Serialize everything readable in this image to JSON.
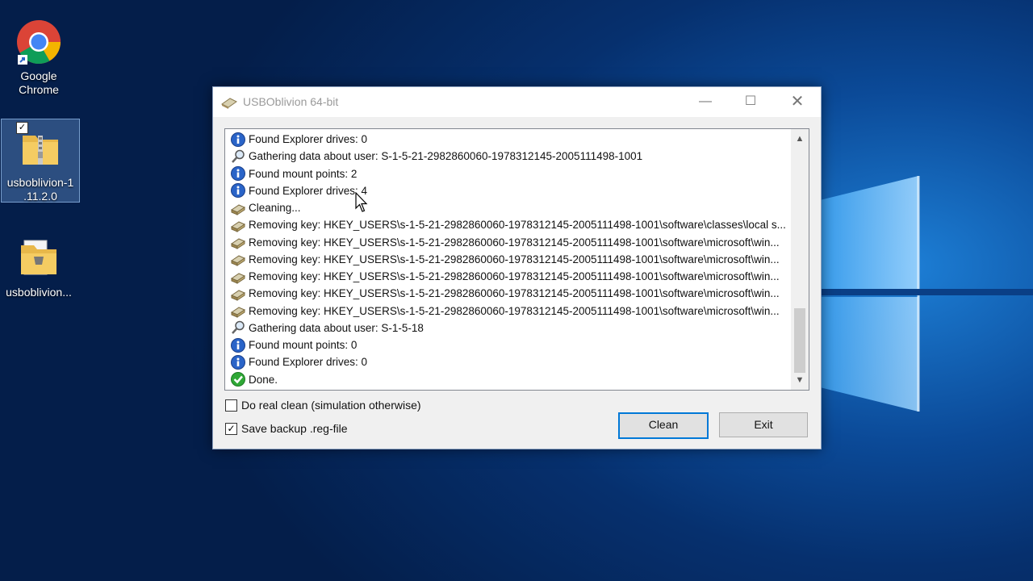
{
  "desktop": {
    "icons": [
      {
        "label": "Google Chrome",
        "label_lines": [
          "Google",
          "Chrome"
        ]
      },
      {
        "label": "usboblivion-1.11.2.0",
        "label_lines": [
          "usboblivion-1",
          ".11.2.0"
        ],
        "checked": "✓"
      },
      {
        "label": "usboblivion...",
        "label_lines": [
          "usboblivion..."
        ]
      }
    ]
  },
  "window": {
    "title": "USBOblivion 64-bit",
    "controls": {
      "minimize": "—",
      "maximize": "☐",
      "close": "✕"
    }
  },
  "log": {
    "lines": [
      {
        "icon": "info-icon",
        "text": "Found Explorer drives: 0"
      },
      {
        "icon": "magnifier-icon",
        "text": "Gathering data about user: S-1-5-21-2982860060-1978312145-2005111498-1001"
      },
      {
        "icon": "info-icon",
        "text": "Found mount points: 2"
      },
      {
        "icon": "info-icon",
        "text": "Found Explorer drives: 4"
      },
      {
        "icon": "eraser-icon",
        "text": "Cleaning..."
      },
      {
        "icon": "eraser-icon",
        "text": "Removing key: HKEY_USERS\\s-1-5-21-2982860060-1978312145-2005111498-1001\\software\\classes\\local s..."
      },
      {
        "icon": "eraser-icon",
        "text": "Removing key: HKEY_USERS\\s-1-5-21-2982860060-1978312145-2005111498-1001\\software\\microsoft\\win..."
      },
      {
        "icon": "eraser-icon",
        "text": "Removing key: HKEY_USERS\\s-1-5-21-2982860060-1978312145-2005111498-1001\\software\\microsoft\\win..."
      },
      {
        "icon": "eraser-icon",
        "text": "Removing key: HKEY_USERS\\s-1-5-21-2982860060-1978312145-2005111498-1001\\software\\microsoft\\win..."
      },
      {
        "icon": "eraser-icon",
        "text": "Removing key: HKEY_USERS\\s-1-5-21-2982860060-1978312145-2005111498-1001\\software\\microsoft\\win..."
      },
      {
        "icon": "eraser-icon",
        "text": "Removing key: HKEY_USERS\\s-1-5-21-2982860060-1978312145-2005111498-1001\\software\\microsoft\\win..."
      },
      {
        "icon": "magnifier-icon",
        "text": "Gathering data about user: S-1-5-18"
      },
      {
        "icon": "info-icon",
        "text": "Found mount points: 0"
      },
      {
        "icon": "info-icon",
        "text": "Found Explorer drives: 0"
      },
      {
        "icon": "check-icon",
        "text": "Done."
      }
    ],
    "scroll_up": "▲",
    "scroll_down": "▼"
  },
  "options": {
    "real_clean": {
      "label": "Do real clean (simulation otherwise)",
      "checked": false,
      "mark": ""
    },
    "save_backup": {
      "label": "Save backup .reg-file",
      "checked": true,
      "mark": "✓"
    }
  },
  "buttons": {
    "clean": "Clean",
    "exit": "Exit"
  },
  "colors": {
    "accent": "#0078d7",
    "info": "#2a64c8",
    "done": "#2fa836"
  }
}
